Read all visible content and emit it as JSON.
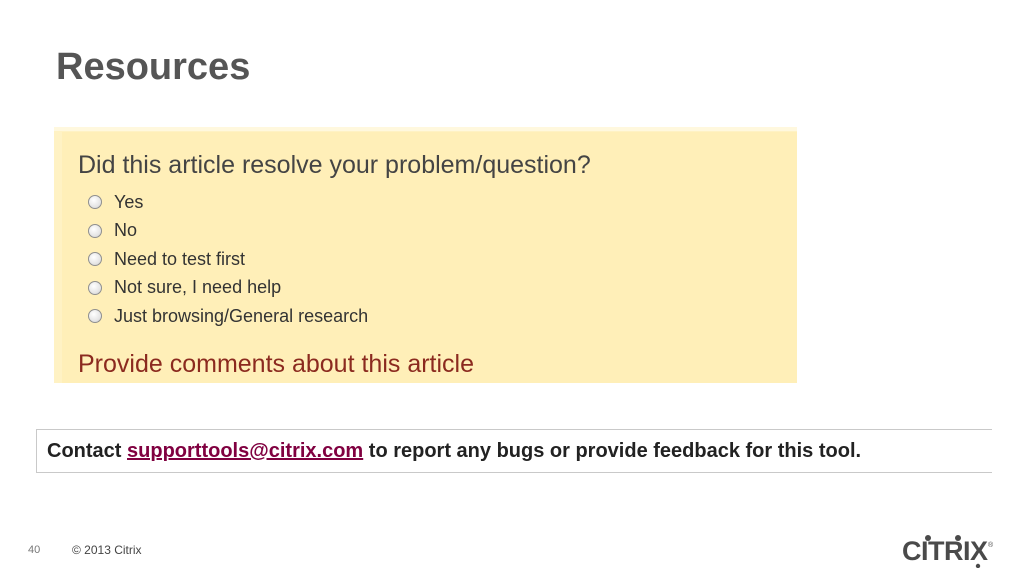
{
  "slide": {
    "title": "Resources",
    "page_number": "40",
    "copyright": "© 2013 Citrix"
  },
  "survey": {
    "question": "Did this article resolve your problem/question?",
    "options": [
      "Yes",
      "No",
      "Need to test first",
      "Not sure, I need help",
      "Just browsing/General research"
    ],
    "comments_heading": "Provide comments about this article"
  },
  "contact": {
    "prefix": "Contact",
    "email": "supporttools@citrix.com",
    "suffix": "to report any bugs or provide feedback for this tool."
  },
  "logo": {
    "text": "CITRIX"
  },
  "colors": {
    "title": "#555555",
    "survey_background": "#ffefb8",
    "comments_heading": "#8b2a1f",
    "link": "#800040"
  }
}
